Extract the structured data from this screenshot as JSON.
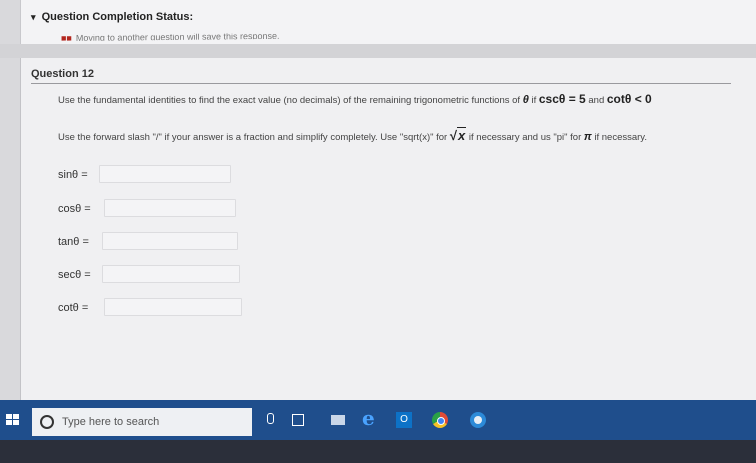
{
  "status": {
    "title": "Question Completion Status:",
    "cut_text": "Moving to another question will save this response."
  },
  "question": {
    "header": "Question 12",
    "line1_prefix": "Use the fundamental identities to find the exact value (no decimals) of the remaining trigonometric functions of",
    "theta": "θ",
    "if": "if",
    "given_expr": "cscθ = 5",
    "and": "and",
    "condition_expr": "cotθ < 0",
    "line2_prefix": "Use the forward slash \"/\" if your answer is a fraction and simplify completely. Use \"sqrt(x)\" for",
    "sqrt_symbol": "√",
    "sqrt_var": "x",
    "line2_mid": "if necessary and us \"pi\" for",
    "pi_symbol": "π",
    "line2_suffix": "if necessary.",
    "functions": [
      {
        "label": "sinθ =",
        "value": ""
      },
      {
        "label": "cosθ =",
        "value": ""
      },
      {
        "label": "tanθ =",
        "value": ""
      },
      {
        "label": "secθ =",
        "value": ""
      },
      {
        "label": "cotθ =",
        "value": ""
      }
    ]
  },
  "taskbar": {
    "search_placeholder": "Type here to search",
    "edge_glyph": "e"
  }
}
